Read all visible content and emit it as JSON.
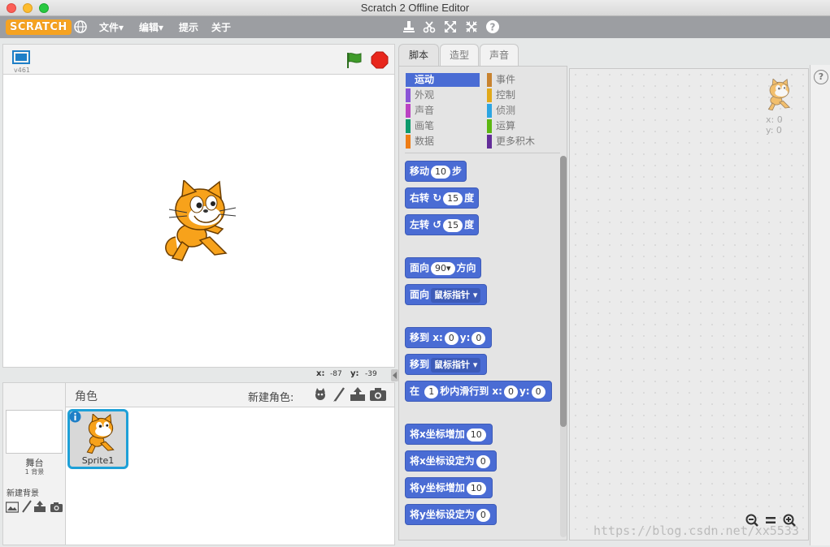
{
  "window": {
    "title": "Scratch 2 Offline Editor"
  },
  "menu": {
    "logo": "SCRATCH",
    "items": [
      "文件▾",
      "编辑▾",
      "提示",
      "关于"
    ]
  },
  "stage": {
    "version": "v461",
    "mouse_x_label": "x:",
    "mouse_x": "-87",
    "mouse_y_label": "y:",
    "mouse_y": "-39"
  },
  "sprites_pane": {
    "title": "角色",
    "new_sprite_label": "新建角色:",
    "stage_label": "舞台",
    "stage_backdrops": "1 背景",
    "new_backdrop_label": "新建背景",
    "sprites": [
      {
        "name": "Sprite1"
      }
    ]
  },
  "tabs": [
    "脚本",
    "造型",
    "声音"
  ],
  "categories_left": [
    {
      "label": "运动",
      "color": "#4a6cd4"
    },
    {
      "label": "外观",
      "color": "#8a55d7"
    },
    {
      "label": "声音",
      "color": "#bb42c3"
    },
    {
      "label": "画笔",
      "color": "#0e9a6c"
    },
    {
      "label": "数据",
      "color": "#ee7d16"
    }
  ],
  "categories_right": [
    {
      "label": "事件",
      "color": "#c88330"
    },
    {
      "label": "控制",
      "color": "#e1a91a"
    },
    {
      "label": "侦测",
      "color": "#2ca5e2"
    },
    {
      "label": "运算",
      "color": "#5cb712"
    },
    {
      "label": "更多积木",
      "color": "#632d99"
    }
  ],
  "blocks": {
    "move": {
      "pre": "移动",
      "val": "10",
      "post": "步"
    },
    "turn_right": {
      "pre": "右转",
      "icon": "↻",
      "val": "15",
      "post": "度"
    },
    "turn_left": {
      "pre": "左转",
      "icon": "↺",
      "val": "15",
      "post": "度"
    },
    "point_dir": {
      "pre": "面向",
      "val": "90▾",
      "post": "方向"
    },
    "point_towards": {
      "pre": "面向",
      "dd": "鼠标指针 ▾"
    },
    "goto_xy": {
      "pre": "移到",
      "xl": "x:",
      "x": "0",
      "yl": "y:",
      "y": "0"
    },
    "goto": {
      "pre": "移到",
      "dd": "鼠标指针 ▾"
    },
    "glide": {
      "pre": "在",
      "val": "1",
      "mid": "秒内滑行到",
      "xl": "x:",
      "x": "0",
      "yl": "y:",
      "y": "0"
    },
    "change_x": {
      "pre": "将x坐标增加",
      "val": "10"
    },
    "set_x": {
      "pre": "将x坐标设定为",
      "val": "0"
    },
    "change_y": {
      "pre": "将y坐标增加",
      "val": "10"
    },
    "set_y": {
      "pre": "将y坐标设定为",
      "val": "0"
    }
  },
  "script_area": {
    "x_label": "x: 0",
    "y_label": "y: 0"
  },
  "help_icon": "?",
  "watermark": "https://blog.csdn.net/xx5533",
  "colors": {
    "motion": "#4a6cd4",
    "menubar": "#9c9ea2",
    "stop": "#e8261c",
    "flag": "#3f9b2a",
    "select_blue": "#1ea0d7"
  }
}
